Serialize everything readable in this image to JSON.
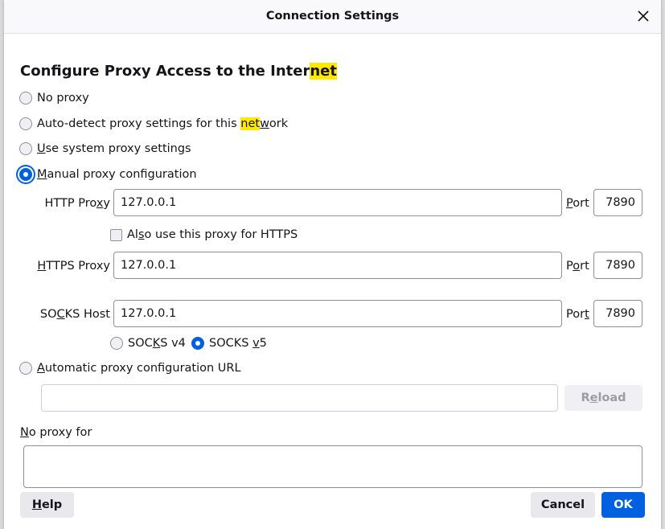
{
  "dialog": {
    "title": "Connection Settings",
    "heading_pre": "Configure Proxy Access to the Inter",
    "heading_hl": "net"
  },
  "options": {
    "no_proxy": "No proxy",
    "auto_detect_pre": "Auto-detect proxy settings for this ",
    "auto_detect_hl": "net",
    "auto_detect_u": "w",
    "auto_detect_post": "ork",
    "system_u": "U",
    "system_rest": "se system proxy settings",
    "manual_u": "M",
    "manual_rest": "anual proxy configuration",
    "auto_url_u": "A",
    "auto_url_rest": "utomatic proxy configuration URL",
    "selected": "manual"
  },
  "http": {
    "label_pre": "HTTP Pro",
    "label_u": "x",
    "label_post": "y",
    "value": "127.0.0.1",
    "port_u": "P",
    "port_rest": "ort",
    "port_value": "7890",
    "also_https_pre": "Al",
    "also_https_u": "s",
    "also_https_post": "o use this proxy for HTTPS",
    "also_https_checked": false
  },
  "https": {
    "label_u": "H",
    "label_rest": "TTPS Proxy",
    "value": "127.0.0.1",
    "port_pre": "P",
    "port_u": "o",
    "port_post": "rt",
    "port_value": "7890"
  },
  "socks": {
    "label_pre": "SO",
    "label_u": "C",
    "label_post": "KS Host",
    "value": "127.0.0.1",
    "port_u": "t",
    "port_pre": "Por",
    "port_value": "7890",
    "v4_pre": "SOC",
    "v4_u": "K",
    "v4_post": "S v4",
    "v5_pre": "SOCKS ",
    "v5_u": "v",
    "v5_post": "5",
    "version_selected": "v5"
  },
  "auto_url": {
    "value": "",
    "reload_pre": "R",
    "reload_u": "e",
    "reload_post": "load"
  },
  "no_proxy_for": {
    "label_u": "N",
    "label_rest": "o proxy for",
    "value": ""
  },
  "buttons": {
    "help_u": "H",
    "help_rest": "elp",
    "cancel": "Cancel",
    "ok": "OK"
  },
  "colors": {
    "accent": "#0061e0",
    "highlight": "#ffe900"
  }
}
